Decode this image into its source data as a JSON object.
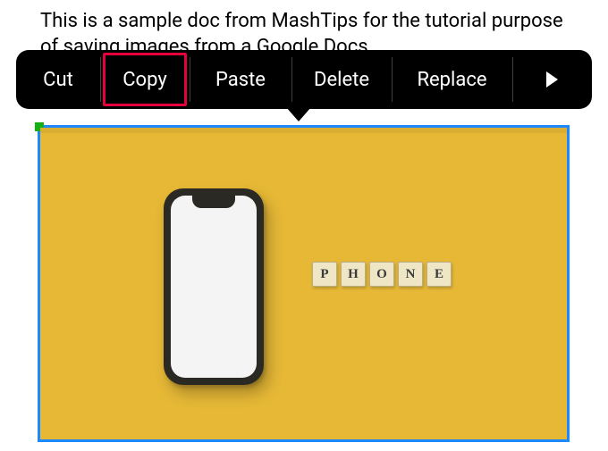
{
  "doc": {
    "paragraph": "This is a sample doc from MashTips for the tutorial purpose of saving images from a Google Docs."
  },
  "context_menu": {
    "cut": "Cut",
    "copy": "Copy",
    "paste": "Paste",
    "delete": "Delete",
    "replace": "Replace"
  },
  "image": {
    "tiles": [
      "P",
      "H",
      "O",
      "N",
      "E"
    ]
  },
  "colors": {
    "selection_border": "#1e88ff",
    "highlight": "#e6003c",
    "yellow": "#e6b836"
  }
}
